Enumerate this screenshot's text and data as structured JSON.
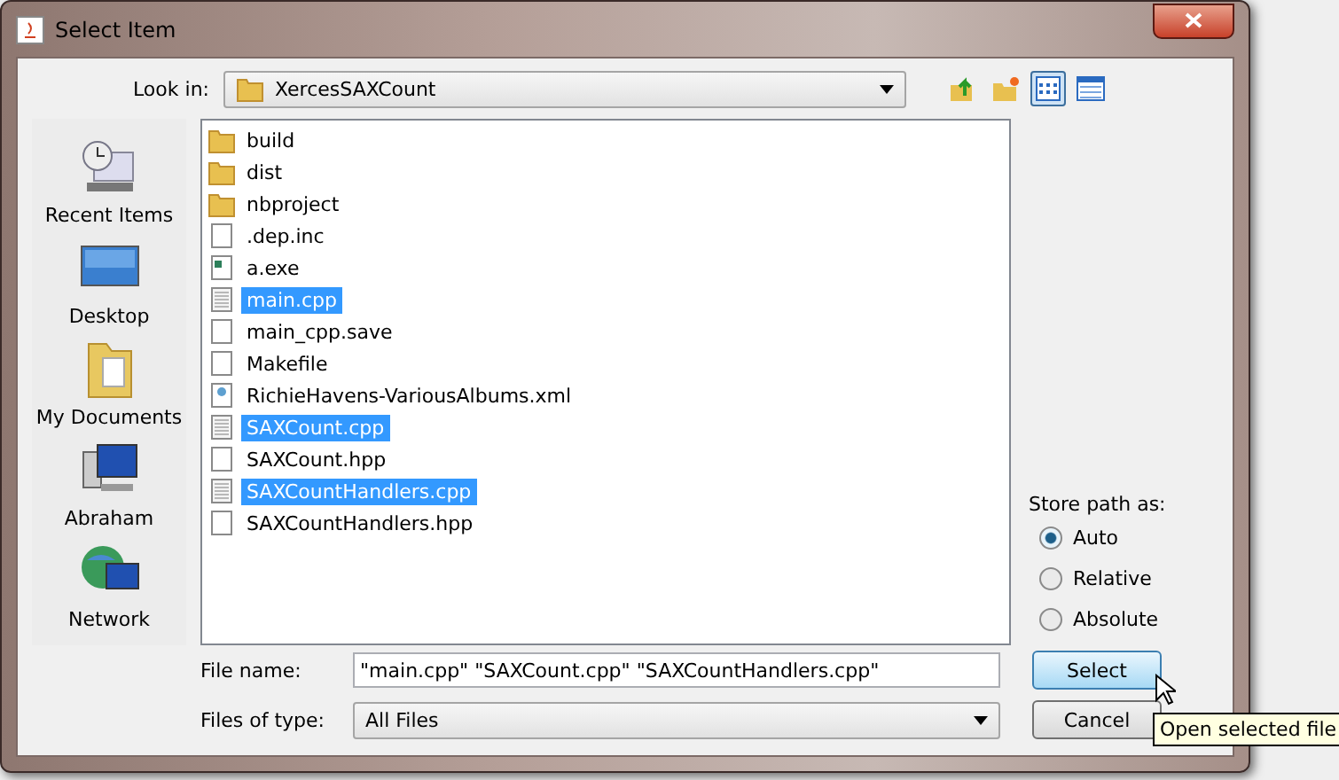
{
  "window": {
    "title": "Select Item"
  },
  "look_in": {
    "label": "Look in:",
    "value": "XercesSAXCount"
  },
  "toolbar": [
    {
      "kind": "up"
    },
    {
      "kind": "new-folder"
    },
    {
      "kind": "list",
      "selected": true
    },
    {
      "kind": "details",
      "selected": false
    }
  ],
  "places": [
    {
      "kind": "recent",
      "label": "Recent Items"
    },
    {
      "kind": "desktop",
      "label": "Desktop"
    },
    {
      "kind": "documents",
      "label": "My Documents"
    },
    {
      "kind": "computer",
      "label": "Abraham"
    },
    {
      "kind": "network",
      "label": "Network"
    }
  ],
  "files": [
    {
      "name": "build",
      "kind": "folder",
      "selected": false
    },
    {
      "name": "dist",
      "kind": "folder",
      "selected": false
    },
    {
      "name": "nbproject",
      "kind": "folder",
      "selected": false
    },
    {
      "name": ".dep.inc",
      "kind": "file",
      "selected": false
    },
    {
      "name": "a.exe",
      "kind": "exe",
      "selected": false
    },
    {
      "name": "main.cpp",
      "kind": "text",
      "selected": true
    },
    {
      "name": "main_cpp.save",
      "kind": "file",
      "selected": false
    },
    {
      "name": "Makefile",
      "kind": "file",
      "selected": false
    },
    {
      "name": "RichieHavens-VariousAlbums.xml",
      "kind": "xml",
      "selected": false
    },
    {
      "name": "SAXCount.cpp",
      "kind": "text",
      "selected": true
    },
    {
      "name": "SAXCount.hpp",
      "kind": "file",
      "selected": false
    },
    {
      "name": "SAXCountHandlers.cpp",
      "kind": "text",
      "selected": true
    },
    {
      "name": "SAXCountHandlers.hpp",
      "kind": "file",
      "selected": false
    }
  ],
  "store_path": {
    "label": "Store path as:",
    "options": [
      {
        "label": "Auto",
        "selected": true
      },
      {
        "label": "Relative",
        "selected": false
      },
      {
        "label": "Absolute",
        "selected": false
      }
    ]
  },
  "file_name": {
    "label": "File name:",
    "value": "\"main.cpp\" \"SAXCount.cpp\" \"SAXCountHandlers.cpp\""
  },
  "file_type": {
    "label": "Files of type:",
    "value": "All Files"
  },
  "buttons": [
    {
      "label": "Select",
      "kind": "default"
    },
    {
      "label": "Cancel",
      "kind": "normal"
    }
  ],
  "tooltip": "Open selected file"
}
